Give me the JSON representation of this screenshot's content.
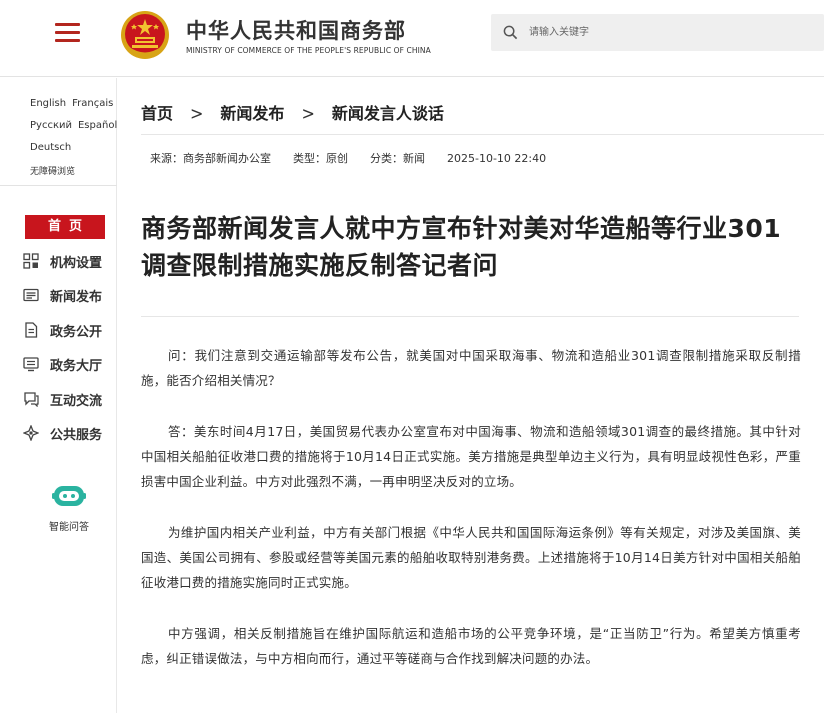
{
  "header": {
    "site_title": "中华人民共和国商务部",
    "site_subtitle": "MINISTRY OF COMMERCE OF THE PEOPLE'S REPUBLIC OF CHINA",
    "search_placeholder": "请输入关键字",
    "brand_color": "#c8151d"
  },
  "languages": {
    "english": "English",
    "french": "Français",
    "russian": "Русский",
    "spanish": "Español",
    "german": "Deutsch",
    "accessibility": "无障碍浏览"
  },
  "nav": {
    "home": "首页",
    "items": [
      {
        "label": "机构设置",
        "icon": "org-grid-icon"
      },
      {
        "label": "新闻发布",
        "icon": "news-icon"
      },
      {
        "label": "政务公开",
        "icon": "document-icon"
      },
      {
        "label": "政务大厅",
        "icon": "hall-icon"
      },
      {
        "label": "互动交流",
        "icon": "chat-icon"
      },
      {
        "label": "公共服务",
        "icon": "service-icon"
      }
    ],
    "assistant_label": "智能问答"
  },
  "breadcrumb": {
    "home": "首页",
    "section": "新闻发布",
    "subsection": "新闻发言人谈话",
    "separator": ">"
  },
  "meta": {
    "source": "来源：商务部新闻办公室",
    "type": "类型：原创",
    "category": "分类：新闻",
    "datetime": "2025-10-10 22:40"
  },
  "article": {
    "title": "商务部新闻发言人就中方宣布针对美对华造船等行业301调查限制措施实施反制答记者问",
    "paragraphs": [
      "问：我们注意到交通运输部等发布公告，就美国对中国采取海事、物流和造船业301调查限制措施采取反制措施，能否介绍相关情况？",
      "答：美东时间4月17日，美国贸易代表办公室宣布对中国海事、物流和造船领域301调查的最终措施。其中针对中国相关船舶征收港口费的措施将于10月14日正式实施。美方措施是典型单边主义行为，具有明显歧视性色彩，严重损害中国企业利益。中方对此强烈不满，一再申明坚决反对的立场。",
      "为维护国内相关产业利益，中方有关部门根据《中华人民共和国国际海运条例》等有关规定，对涉及美国旗、美国造、美国公司拥有、参股或经营等美国元素的船舶收取特别港务费。上述措施将于10月14日美方针对中国相关船舶征收港口费的措施实施同时正式实施。",
      "中方强调，相关反制措施旨在维护国际航运和造船市场的公平竞争环境，是“正当防卫”行为。希望美方慎重考虑，纠正错误做法，与中方相向而行，通过平等磋商与合作找到解决问题的办法。"
    ]
  }
}
